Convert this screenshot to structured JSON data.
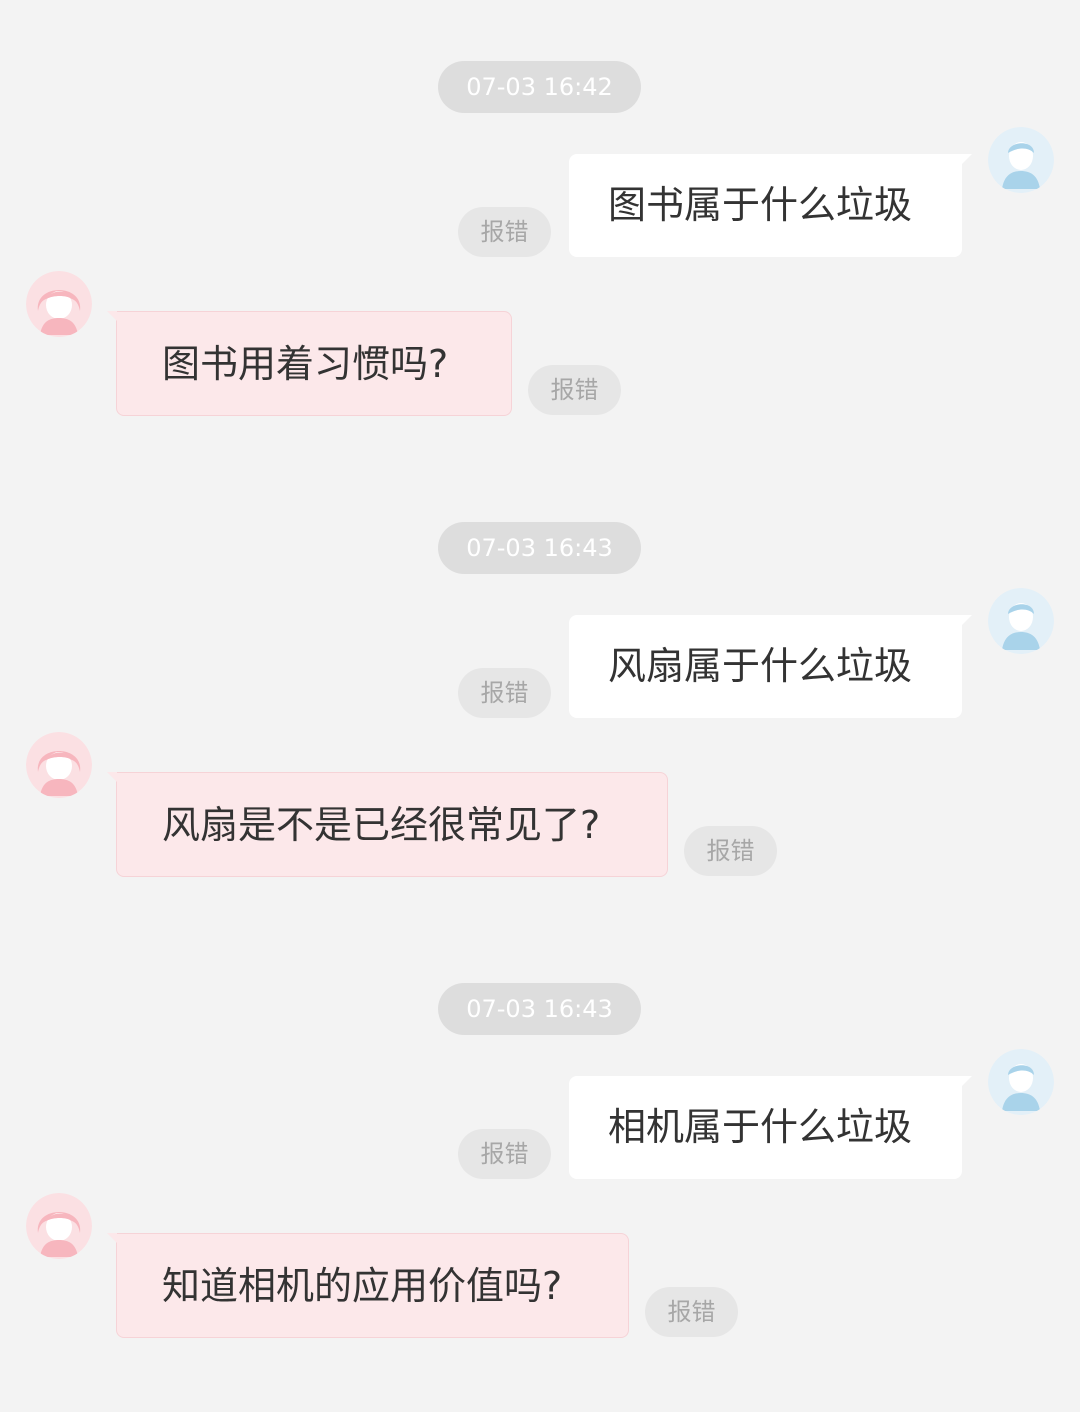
{
  "messages": [
    {
      "timestamp": "07-03 16:42",
      "question": "图书属于什么垃圾",
      "answer": "图书用着习惯吗?",
      "report_user": "报错",
      "report_bot": "报错"
    },
    {
      "timestamp": "07-03 16:43",
      "question": "风扇属于什么垃圾",
      "answer": "风扇是不是已经很常见了?",
      "report_user": "报错",
      "report_bot": "报错"
    },
    {
      "timestamp": "07-03 16:43",
      "question": "相机属于什么垃圾",
      "answer": "知道相机的应用价值吗?",
      "report_user": "报错",
      "report_bot": "报错"
    }
  ],
  "colors": {
    "background": "#f3f3f3",
    "user_bubble": "#ffffff",
    "bot_bubble": "#fce8ea",
    "timestamp_pill": "#dddddd",
    "report_pill": "#e6e6e6",
    "user_avatar": "#cfe6f3",
    "bot_avatar": "#f9c6cc"
  },
  "icons": {
    "user_avatar": "boy-avatar-icon",
    "bot_avatar": "girl-avatar-icon"
  }
}
